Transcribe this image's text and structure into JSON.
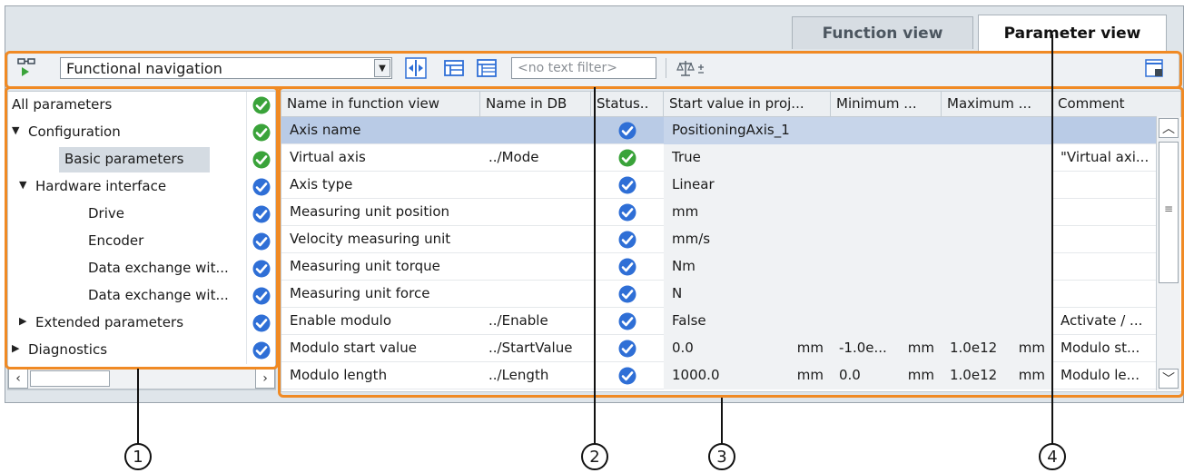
{
  "tabs": [
    {
      "label": "Function view",
      "active": false
    },
    {
      "label": "Parameter view",
      "active": true
    }
  ],
  "toolbar": {
    "navigation_icon": "navigation-icon",
    "navigation_select": "Functional navigation",
    "expand_icon": "expand-all-icon",
    "collapse_icon": "collapse-icon",
    "filter_icon": "filter-tree-icon",
    "text_filter_placeholder": "<no text filter>",
    "compare_icon": "compare-values-icon",
    "settings_icon": "window-settings-icon"
  },
  "tree": [
    {
      "label": "All parameters",
      "level": 0,
      "expander": "none",
      "status": "green"
    },
    {
      "label": "Configuration",
      "level": 0,
      "expander": "expanded",
      "status": "green"
    },
    {
      "label": "Basic parameters",
      "level": 2,
      "expander": "none",
      "status": "green",
      "selected": true
    },
    {
      "label": "Hardware interface",
      "level": 1,
      "expander": "expanded",
      "status": "blue"
    },
    {
      "label": "Drive",
      "level": 3,
      "expander": "none",
      "status": "blue"
    },
    {
      "label": "Encoder",
      "level": 3,
      "expander": "none",
      "status": "blue"
    },
    {
      "label": "Data exchange wit...",
      "level": 3,
      "expander": "none",
      "status": "blue"
    },
    {
      "label": "Data exchange wit...",
      "level": 3,
      "expander": "none",
      "status": "blue"
    },
    {
      "label": "Extended parameters",
      "level": 1,
      "expander": "collapsed",
      "status": "blue"
    },
    {
      "label": "Diagnostics",
      "level": 0,
      "expander": "collapsed",
      "status": "blue"
    }
  ],
  "table": {
    "columns": [
      "Name in function view",
      "Name in DB",
      "Status..",
      "Start value in proj...",
      "Minimum ...",
      "Maximum ...",
      "Comment"
    ],
    "rows": [
      {
        "name": "Axis name",
        "db": "",
        "status": "blue",
        "start": "PositioningAxis_1",
        "start_unit": "",
        "min": "",
        "min_unit": "",
        "max": "",
        "max_unit": "",
        "comment": "",
        "selected": true
      },
      {
        "name": "Virtual axis",
        "db": "../Mode",
        "status": "green",
        "start": "True",
        "start_unit": "",
        "min": "",
        "min_unit": "",
        "max": "",
        "max_unit": "",
        "comment": "\"Virtual axi..."
      },
      {
        "name": "Axis type",
        "db": "",
        "status": "blue",
        "start": "Linear",
        "start_unit": "",
        "min": "",
        "min_unit": "",
        "max": "",
        "max_unit": "",
        "comment": ""
      },
      {
        "name": "Measuring unit position",
        "db": "",
        "status": "blue",
        "start": "mm",
        "start_unit": "",
        "min": "",
        "min_unit": "",
        "max": "",
        "max_unit": "",
        "comment": ""
      },
      {
        "name": "Velocity measuring unit",
        "db": "",
        "status": "blue",
        "start": "mm/s",
        "start_unit": "",
        "min": "",
        "min_unit": "",
        "max": "",
        "max_unit": "",
        "comment": ""
      },
      {
        "name": "Measuring unit torque",
        "db": "",
        "status": "blue",
        "start": "Nm",
        "start_unit": "",
        "min": "",
        "min_unit": "",
        "max": "",
        "max_unit": "",
        "comment": ""
      },
      {
        "name": "Measuring unit force",
        "db": "",
        "status": "blue",
        "start": "N",
        "start_unit": "",
        "min": "",
        "min_unit": "",
        "max": "",
        "max_unit": "",
        "comment": ""
      },
      {
        "name": "Enable modulo",
        "db": "../Enable",
        "status": "blue",
        "start": "False",
        "start_unit": "",
        "min": "",
        "min_unit": "",
        "max": "",
        "max_unit": "",
        "comment": "Activate / ..."
      },
      {
        "name": "Modulo start value",
        "db": "../StartValue",
        "status": "blue",
        "start": "0.0",
        "start_unit": "mm",
        "min": "-1.0e...",
        "min_unit": "mm",
        "max": "1.0e12",
        "max_unit": "mm",
        "comment": "Modulo st..."
      },
      {
        "name": "Modulo length",
        "db": "../Length",
        "status": "blue",
        "start": "1000.0",
        "start_unit": "mm",
        "min": "0.0",
        "min_unit": "mm",
        "max": "1.0e12",
        "max_unit": "mm",
        "comment": "Modulo le..."
      }
    ]
  },
  "callouts": [
    "1",
    "2",
    "3",
    "4"
  ],
  "colors": {
    "highlight": "#f08a24",
    "status_green": "#3aa33a",
    "status_blue": "#2f6fd6",
    "selected_row": "#b9cbe6"
  }
}
